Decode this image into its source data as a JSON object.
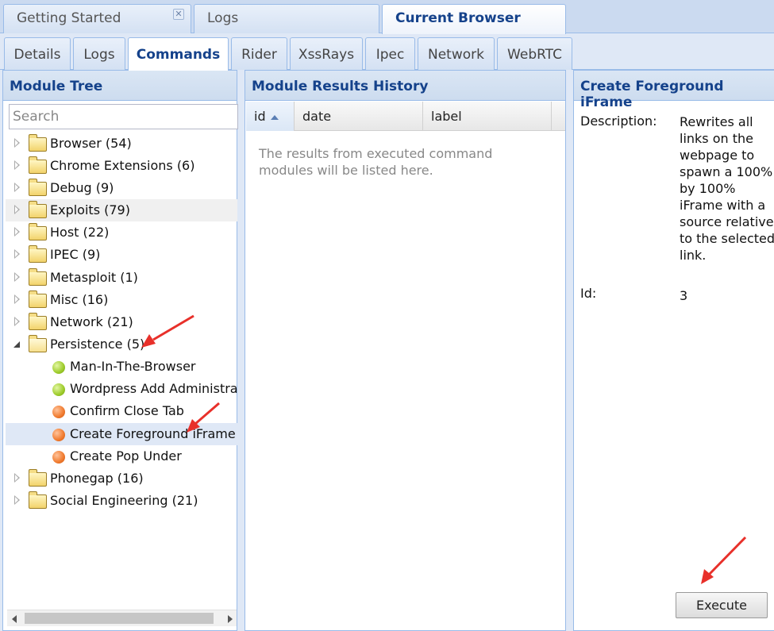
{
  "top_tabs": [
    {
      "label": "Getting Started",
      "closable": true,
      "active": false
    },
    {
      "label": "Logs",
      "active": false
    },
    {
      "label": "Current Browser",
      "active": true
    }
  ],
  "sub_tabs": [
    "Details",
    "Logs",
    "Commands",
    "Rider",
    "XssRays",
    "Ipec",
    "Network",
    "WebRTC"
  ],
  "sub_tab_active": "Commands",
  "module_tree": {
    "title": "Module Tree",
    "search_placeholder": "Search",
    "items": [
      {
        "label": "Browser (54)"
      },
      {
        "label": "Chrome Extensions (6)"
      },
      {
        "label": "Debug (9)"
      },
      {
        "label": "Exploits (79)"
      },
      {
        "label": "Host (22)"
      },
      {
        "label": "IPEC (9)"
      },
      {
        "label": "Metasploit (1)"
      },
      {
        "label": "Misc (16)"
      },
      {
        "label": "Network (21)"
      },
      {
        "label": "Persistence (5)",
        "expanded": true
      },
      {
        "label": "Man-In-The-Browser",
        "status": "green"
      },
      {
        "label": "Wordpress Add Administrator",
        "status": "green"
      },
      {
        "label": "Confirm Close Tab",
        "status": "orange"
      },
      {
        "label": "Create Foreground iFrame",
        "status": "orange",
        "selected": true
      },
      {
        "label": "Create Pop Under",
        "status": "orange"
      },
      {
        "label": "Phonegap (16)"
      },
      {
        "label": "Social Engineering (21)"
      }
    ]
  },
  "results": {
    "title": "Module Results History",
    "columns": [
      "id",
      "date",
      "label"
    ],
    "sorted_column": "id",
    "empty_message": "The results from executed command modules will be listed here."
  },
  "details": {
    "title": "Create Foreground iFrame",
    "description_label": "Description:",
    "description_value": "Rewrites all links on the webpage to spawn a 100% by 100% iFrame with a source relative to the selected link.",
    "id_label": "Id:",
    "id_value": "3",
    "execute_label": "Execute"
  },
  "colors": {
    "accent": "#15428b",
    "border": "#99bbe8",
    "annotation_arrow": "#e8302a"
  }
}
